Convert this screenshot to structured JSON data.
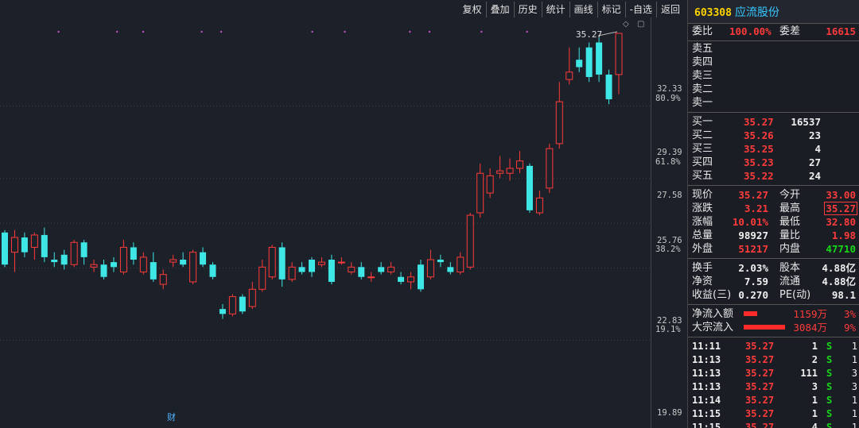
{
  "toolbar": [
    "复权",
    "叠加",
    "历史",
    "统计",
    "画线",
    "标记",
    "-自选",
    "返回"
  ],
  "stock": {
    "code": "603308",
    "name": "应流股份"
  },
  "axis": {
    "prices": [
      "32.33",
      "29.39",
      "27.58",
      "25.76",
      "22.83",
      "19.89"
    ],
    "pcts": [
      "80.9%",
      "61.8%",
      "38.2%",
      "19.1%"
    ]
  },
  "annotations": {
    "peak": "35.27",
    "fin": "财"
  },
  "order_ratio": {
    "label1": "委比",
    "value1": "100.00%",
    "label2": "委差",
    "value2": "16615"
  },
  "asks": [
    {
      "label": "卖五",
      "price": "",
      "vol": ""
    },
    {
      "label": "卖四",
      "price": "",
      "vol": ""
    },
    {
      "label": "卖三",
      "price": "",
      "vol": ""
    },
    {
      "label": "卖二",
      "price": "",
      "vol": ""
    },
    {
      "label": "卖一",
      "price": "",
      "vol": ""
    }
  ],
  "bids": [
    {
      "label": "买一",
      "price": "35.27",
      "vol": "16537"
    },
    {
      "label": "买二",
      "price": "35.26",
      "vol": "23"
    },
    {
      "label": "买三",
      "price": "35.25",
      "vol": "4"
    },
    {
      "label": "买四",
      "price": "35.23",
      "vol": "27"
    },
    {
      "label": "买五",
      "price": "35.22",
      "vol": "24"
    }
  ],
  "stats1": [
    {
      "l1": "现价",
      "v1": "35.27",
      "c1": "red",
      "l2": "今开",
      "v2": "33.00",
      "c2": "red"
    },
    {
      "l1": "涨跌",
      "v1": "3.21",
      "c1": "red",
      "l2": "最高",
      "v2": "35.27",
      "c2": "red"
    },
    {
      "l1": "涨幅",
      "v1": "10.01%",
      "c1": "red",
      "l2": "最低",
      "v2": "32.80",
      "c2": "red"
    },
    {
      "l1": "总量",
      "v1": "98927",
      "c1": "white",
      "l2": "量比",
      "v2": "1.98",
      "c2": "red"
    },
    {
      "l1": "外盘",
      "v1": "51217",
      "c1": "red",
      "l2": "内盘",
      "v2": "47710",
      "c2": "green"
    }
  ],
  "stats2": [
    {
      "l1": "换手",
      "v1": "2.03%",
      "l2": "股本",
      "v2": "4.88亿"
    },
    {
      "l1": "净资",
      "v1": "7.59",
      "l2": "流通",
      "v2": "4.88亿"
    },
    {
      "l1": "收益(三)",
      "v1": "0.270",
      "l2": "PE(动)",
      "v2": "98.1"
    }
  ],
  "flows": [
    {
      "label": "净流入额",
      "amount": "1159万",
      "pct": "3%",
      "bar": 0.33
    },
    {
      "label": "大宗流入",
      "amount": "3084万",
      "pct": "9%",
      "bar": 1.0
    }
  ],
  "ticks": [
    {
      "time": "11:11",
      "price": "35.27",
      "vol": "1",
      "side": "S",
      "n": "1"
    },
    {
      "time": "11:13",
      "price": "35.27",
      "vol": "2",
      "side": "S",
      "n": "1"
    },
    {
      "time": "11:13",
      "price": "35.27",
      "vol": "111",
      "side": "S",
      "n": "3"
    },
    {
      "time": "11:13",
      "price": "35.27",
      "vol": "3",
      "side": "S",
      "n": "3"
    },
    {
      "time": "11:14",
      "price": "35.27",
      "vol": "1",
      "side": "S",
      "n": "1"
    },
    {
      "time": "11:15",
      "price": "35.27",
      "vol": "1",
      "side": "S",
      "n": "1"
    },
    {
      "time": "11:15",
      "price": "35.27",
      "vol": "4",
      "side": "S",
      "n": "1"
    }
  ],
  "colors": {
    "up": "#ff3b3b",
    "down": "#3ee6e6",
    "bg": "#1c2028",
    "grid": "#3a3f4a"
  },
  "candles": [
    {
      "o": 27.2,
      "c": 25.9,
      "h": 27.3,
      "l": 25.8
    },
    {
      "o": 26.4,
      "c": 27.0,
      "h": 27.3,
      "l": 25.6
    },
    {
      "o": 27.0,
      "c": 26.4,
      "h": 27.2,
      "l": 26.2
    },
    {
      "o": 26.6,
      "c": 27.1,
      "h": 27.2,
      "l": 26.1
    },
    {
      "o": 27.1,
      "c": 26.2,
      "h": 27.4,
      "l": 26.0
    },
    {
      "o": 26.1,
      "c": 26.0,
      "h": 26.4,
      "l": 25.8
    },
    {
      "o": 26.3,
      "c": 25.9,
      "h": 26.5,
      "l": 25.7
    },
    {
      "o": 25.9,
      "c": 26.8,
      "h": 26.9,
      "l": 25.8
    },
    {
      "o": 26.8,
      "c": 26.2,
      "h": 26.9,
      "l": 25.9
    },
    {
      "o": 25.8,
      "c": 25.9,
      "h": 26.1,
      "l": 25.6
    },
    {
      "o": 25.9,
      "c": 25.4,
      "h": 26.1,
      "l": 25.3
    },
    {
      "o": 26.0,
      "c": 25.8,
      "h": 26.2,
      "l": 25.6
    },
    {
      "o": 25.6,
      "c": 26.6,
      "h": 26.9,
      "l": 25.5
    },
    {
      "o": 26.6,
      "c": 26.1,
      "h": 26.8,
      "l": 25.9
    },
    {
      "o": 25.6,
      "c": 26.2,
      "h": 26.4,
      "l": 25.5
    },
    {
      "o": 26.0,
      "c": 25.3,
      "h": 26.4,
      "l": 25.2
    },
    {
      "o": 25.1,
      "c": 25.5,
      "h": 25.7,
      "l": 24.9
    },
    {
      "o": 26.0,
      "c": 26.1,
      "h": 26.3,
      "l": 25.8
    },
    {
      "o": 26.1,
      "c": 25.9,
      "h": 26.4,
      "l": 25.8
    },
    {
      "o": 25.2,
      "c": 26.4,
      "h": 26.5,
      "l": 25.1
    },
    {
      "o": 26.4,
      "c": 25.9,
      "h": 26.6,
      "l": 25.8
    },
    {
      "o": 25.9,
      "c": 25.4,
      "h": 26.0,
      "l": 25.3
    },
    {
      "o": 24.1,
      "c": 23.9,
      "h": 24.3,
      "l": 23.7
    },
    {
      "o": 23.9,
      "c": 24.6,
      "h": 24.7,
      "l": 23.8
    },
    {
      "o": 24.6,
      "c": 24.0,
      "h": 24.7,
      "l": 23.9
    },
    {
      "o": 24.2,
      "c": 24.9,
      "h": 25.2,
      "l": 24.1
    },
    {
      "o": 24.9,
      "c": 25.8,
      "h": 26.1,
      "l": 24.8
    },
    {
      "o": 25.4,
      "c": 26.6,
      "h": 26.7,
      "l": 25.3
    },
    {
      "o": 26.6,
      "c": 25.3,
      "h": 26.8,
      "l": 25.0
    },
    {
      "o": 25.3,
      "c": 25.8,
      "h": 26.0,
      "l": 25.2
    },
    {
      "o": 25.8,
      "c": 25.6,
      "h": 26.0,
      "l": 25.5
    },
    {
      "o": 26.1,
      "c": 25.6,
      "h": 26.2,
      "l": 25.4
    },
    {
      "o": 25.9,
      "c": 26.0,
      "h": 26.2,
      "l": 25.8
    },
    {
      "o": 26.1,
      "c": 25.2,
      "h": 26.3,
      "l": 25.1
    },
    {
      "o": 26.0,
      "c": 26.0,
      "h": 26.2,
      "l": 25.9
    },
    {
      "o": 25.6,
      "c": 25.8,
      "h": 26.0,
      "l": 25.5
    },
    {
      "o": 25.8,
      "c": 25.4,
      "h": 26.0,
      "l": 25.3
    },
    {
      "o": 25.4,
      "c": 25.4,
      "h": 25.6,
      "l": 25.2
    },
    {
      "o": 25.8,
      "c": 25.6,
      "h": 26.0,
      "l": 25.5
    },
    {
      "o": 25.6,
      "c": 25.8,
      "h": 26.0,
      "l": 25.5
    },
    {
      "o": 25.4,
      "c": 25.2,
      "h": 25.6,
      "l": 25.1
    },
    {
      "o": 25.2,
      "c": 25.4,
      "h": 25.6,
      "l": 24.9
    },
    {
      "o": 25.9,
      "c": 24.9,
      "h": 26.1,
      "l": 24.8
    },
    {
      "o": 25.4,
      "c": 26.1,
      "h": 26.5,
      "l": 25.3
    },
    {
      "o": 26.1,
      "c": 26.0,
      "h": 26.3,
      "l": 25.8
    },
    {
      "o": 25.8,
      "c": 25.6,
      "h": 26.0,
      "l": 25.5
    },
    {
      "o": 25.6,
      "c": 26.2,
      "h": 26.4,
      "l": 25.5
    },
    {
      "o": 25.8,
      "c": 27.9,
      "h": 28.0,
      "l": 25.7
    },
    {
      "o": 28.0,
      "c": 29.6,
      "h": 30.0,
      "l": 27.8
    },
    {
      "o": 28.8,
      "c": 29.5,
      "h": 29.8,
      "l": 28.6
    },
    {
      "o": 29.6,
      "c": 29.7,
      "h": 30.3,
      "l": 29.4
    },
    {
      "o": 29.6,
      "c": 29.8,
      "h": 30.2,
      "l": 29.3
    },
    {
      "o": 29.8,
      "c": 30.1,
      "h": 30.5,
      "l": 29.6
    },
    {
      "o": 29.9,
      "c": 28.1,
      "h": 30.0,
      "l": 28.0
    },
    {
      "o": 28.0,
      "c": 28.6,
      "h": 28.9,
      "l": 27.9
    },
    {
      "o": 29.0,
      "c": 30.6,
      "h": 30.8,
      "l": 28.8
    },
    {
      "o": 30.8,
      "c": 32.5,
      "h": 33.3,
      "l": 30.6
    },
    {
      "o": 33.4,
      "c": 33.7,
      "h": 34.7,
      "l": 33.2
    },
    {
      "o": 34.2,
      "c": 33.9,
      "h": 34.7,
      "l": 33.7
    },
    {
      "o": 34.7,
      "c": 33.5,
      "h": 34.9,
      "l": 33.3
    },
    {
      "o": 34.9,
      "c": 33.6,
      "h": 35.1,
      "l": 33.3
    },
    {
      "o": 33.6,
      "c": 32.6,
      "h": 33.8,
      "l": 32.4
    },
    {
      "o": 33.6,
      "c": 35.27,
      "h": 35.27,
      "l": 32.8
    }
  ],
  "purple_dots": [
    0.09,
    0.18,
    0.22,
    0.31,
    0.34,
    0.48,
    0.53,
    0.63,
    0.66,
    0.74,
    0.81
  ]
}
